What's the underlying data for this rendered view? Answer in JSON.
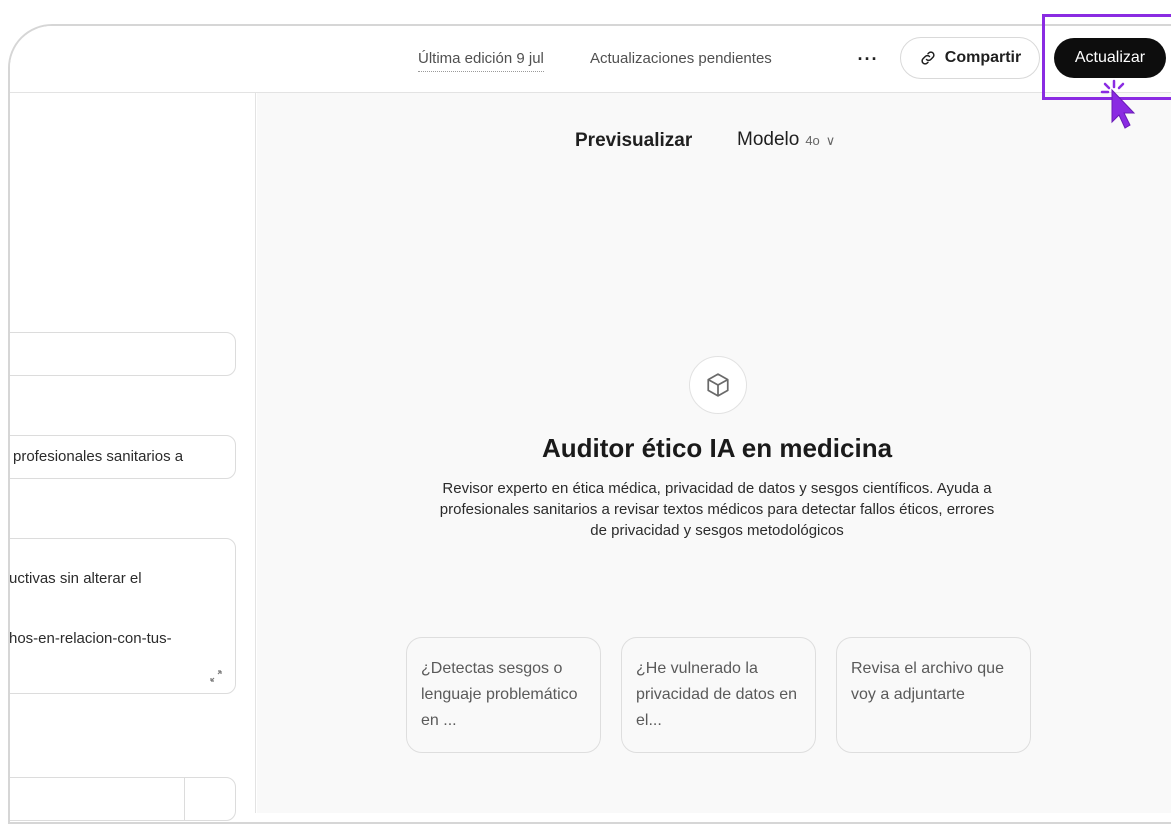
{
  "header": {
    "last_edit": "Última edición 9 jul",
    "pending_updates": "Actualizaciones pendientes",
    "more_label": "···",
    "share_label": "Compartir",
    "update_label": "Actualizar"
  },
  "left_panel": {
    "field_1_value": "",
    "field_2_value": "profesionales sanitarios a",
    "field_3_line_1": "uctivas sin alterar el",
    "field_3_line_2": "hos-en-relacion-con-tus-",
    "expand_glyph": "↙↗"
  },
  "preview": {
    "tab_label": "Previsualizar",
    "model_label": "Modelo",
    "model_version": "4o",
    "chevron": "∨",
    "gpt_name": "Auditor ético IA en medicina",
    "gpt_description": "Revisor experto en ética médica, privacidad de datos y sesgos científicos. Ayuda a profesionales sanitarios a revisar textos médicos para detectar fallos éticos, errores de privacidad y sesgos metodológicos",
    "conversation_starters": [
      "¿Detectas sesgos o lenguaje problemático en ...",
      "¿He vulnerado la privacidad de datos en el...",
      "Revisa el archivo que voy a adjuntarte"
    ]
  },
  "colors": {
    "highlight": "#8a2be2",
    "update_button": "#0d0d0d",
    "preview_bg": "#f9f9f9"
  },
  "icons": [
    "link-icon",
    "cube-icon",
    "cursor-click-icon",
    "expand-icon"
  ]
}
